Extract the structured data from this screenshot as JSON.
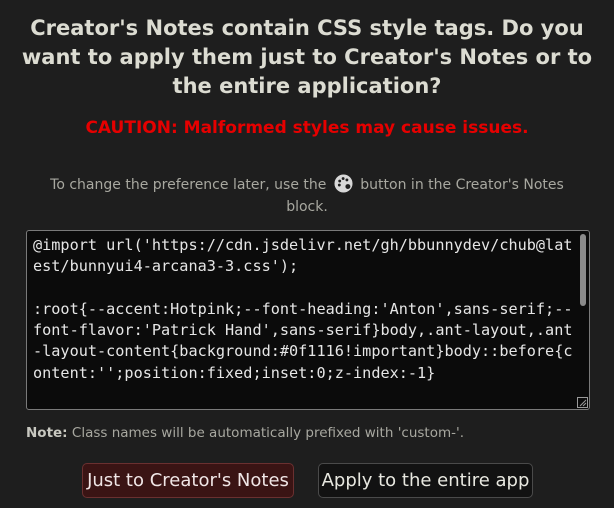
{
  "dialog": {
    "title": "Creator's Notes contain CSS style tags. Do you want to apply them just to Creator's Notes or to the entire application?",
    "caution": "CAUTION: Malformed styles may cause issues.",
    "preference_before": "To change the preference later, use the",
    "preference_icon": "palette-icon",
    "preference_after": "button in the Creator's Notes block.",
    "code": "@import url('https://cdn.jsdelivr.net/gh/bbunnydev/chub@latest/bunnyui4-arcana3-3.css');\n\n:root{--accent:Hotpink;--font-heading:'Anton',sans-serif;--font-flavor:'Patrick Hand',sans-serif}body,.ant-layout,.ant-layout-content{background:#0f1116!important}body::before{content:'';position:fixed;inset:0;z-index:-1}",
    "note_label": "Note:",
    "note_text": "Class names will be automatically prefixed with 'custom-'.",
    "buttons": {
      "just_creator_notes": "Just to Creator's Notes",
      "entire_app": "Apply to the entire app"
    }
  },
  "colors": {
    "background": "#1e1e1e",
    "caution": "#e60000",
    "primary_button": "#3a1414",
    "code_background": "#0b0b0b"
  }
}
